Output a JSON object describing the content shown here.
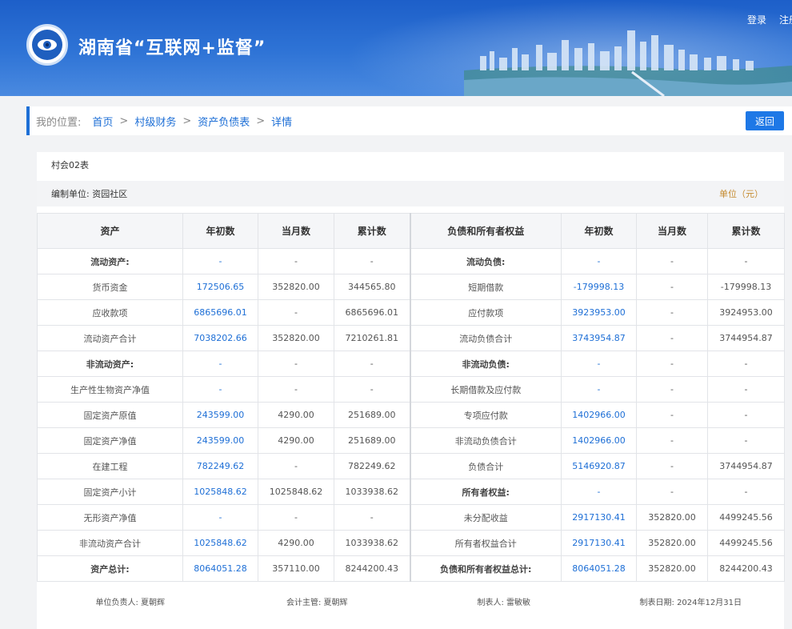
{
  "header": {
    "title": "湖南省“互联网+监督”",
    "login": "登录",
    "register": "注册"
  },
  "breadcrumb": {
    "label": "我的位置:",
    "items": [
      "首页",
      "村级财务",
      "资产负债表",
      "详情"
    ],
    "back": "返回"
  },
  "report": {
    "form_no": "村会02表",
    "org": "编制单位: 资园社区",
    "unit": "单位（元）",
    "columns": [
      "资产",
      "年初数",
      "当月数",
      "累计数",
      "负债和所有者权益",
      "年初数",
      "当月数",
      "累计数"
    ],
    "rows": [
      [
        {
          "t": "流动资产:",
          "b": true
        },
        {
          "t": "-",
          "c": "blue"
        },
        {
          "t": "-"
        },
        {
          "t": "-"
        },
        {
          "t": "流动负债:",
          "b": true
        },
        {
          "t": "-",
          "c": "blue"
        },
        {
          "t": "-"
        },
        {
          "t": "-"
        }
      ],
      [
        {
          "t": "货币资金"
        },
        {
          "t": "172506.65",
          "c": "blue"
        },
        {
          "t": "352820.00"
        },
        {
          "t": "344565.80"
        },
        {
          "t": "短期借款"
        },
        {
          "t": "-179998.13",
          "c": "blue"
        },
        {
          "t": "-"
        },
        {
          "t": "-179998.13"
        }
      ],
      [
        {
          "t": "应收款项"
        },
        {
          "t": "6865696.01",
          "c": "blue"
        },
        {
          "t": "-"
        },
        {
          "t": "6865696.01"
        },
        {
          "t": "应付款项"
        },
        {
          "t": "3923953.00",
          "c": "blue"
        },
        {
          "t": "-"
        },
        {
          "t": "3924953.00"
        }
      ],
      [
        {
          "t": "流动资产合计"
        },
        {
          "t": "7038202.66",
          "c": "blue"
        },
        {
          "t": "352820.00"
        },
        {
          "t": "7210261.81"
        },
        {
          "t": "流动负债合计"
        },
        {
          "t": "3743954.87",
          "c": "blue"
        },
        {
          "t": "-"
        },
        {
          "t": "3744954.87"
        }
      ],
      [
        {
          "t": "非流动资产:",
          "b": true
        },
        {
          "t": "-",
          "c": "blue"
        },
        {
          "t": "-"
        },
        {
          "t": "-"
        },
        {
          "t": "非流动负债:",
          "b": true
        },
        {
          "t": "-",
          "c": "blue"
        },
        {
          "t": "-"
        },
        {
          "t": "-"
        }
      ],
      [
        {
          "t": "生产性生物资产净值"
        },
        {
          "t": "-",
          "c": "blue"
        },
        {
          "t": "-"
        },
        {
          "t": "-"
        },
        {
          "t": "长期借款及应付款"
        },
        {
          "t": "-",
          "c": "blue"
        },
        {
          "t": "-"
        },
        {
          "t": "-"
        }
      ],
      [
        {
          "t": "固定资产原值"
        },
        {
          "t": "243599.00",
          "c": "blue"
        },
        {
          "t": "4290.00"
        },
        {
          "t": "251689.00"
        },
        {
          "t": "专项应付款"
        },
        {
          "t": "1402966.00",
          "c": "blue"
        },
        {
          "t": "-"
        },
        {
          "t": "-"
        }
      ],
      [
        {
          "t": "固定资产净值"
        },
        {
          "t": "243599.00",
          "c": "blue"
        },
        {
          "t": "4290.00"
        },
        {
          "t": "251689.00"
        },
        {
          "t": "非流动负债合计"
        },
        {
          "t": "1402966.00",
          "c": "blue"
        },
        {
          "t": "-"
        },
        {
          "t": "-"
        }
      ],
      [
        {
          "t": "在建工程"
        },
        {
          "t": "782249.62",
          "c": "blue"
        },
        {
          "t": "-"
        },
        {
          "t": "782249.62"
        },
        {
          "t": "负债合计"
        },
        {
          "t": "5146920.87",
          "c": "blue"
        },
        {
          "t": "-"
        },
        {
          "t": "3744954.87"
        }
      ],
      [
        {
          "t": "固定资产小计"
        },
        {
          "t": "1025848.62",
          "c": "blue"
        },
        {
          "t": "1025848.62"
        },
        {
          "t": "1033938.62"
        },
        {
          "t": "所有者权益:",
          "b": true
        },
        {
          "t": "-",
          "c": "blue"
        },
        {
          "t": "-"
        },
        {
          "t": "-"
        }
      ],
      [
        {
          "t": "无形资产净值"
        },
        {
          "t": "-",
          "c": "blue"
        },
        {
          "t": "-"
        },
        {
          "t": "-"
        },
        {
          "t": "未分配收益"
        },
        {
          "t": "2917130.41",
          "c": "blue"
        },
        {
          "t": "352820.00"
        },
        {
          "t": "4499245.56"
        }
      ],
      [
        {
          "t": "非流动资产合计"
        },
        {
          "t": "1025848.62",
          "c": "blue"
        },
        {
          "t": "4290.00"
        },
        {
          "t": "1033938.62"
        },
        {
          "t": "所有者权益合计"
        },
        {
          "t": "2917130.41",
          "c": "blue"
        },
        {
          "t": "352820.00"
        },
        {
          "t": "4499245.56"
        }
      ],
      [
        {
          "t": "资产总计:",
          "b": true
        },
        {
          "t": "8064051.28",
          "c": "blue"
        },
        {
          "t": "357110.00"
        },
        {
          "t": "8244200.43"
        },
        {
          "t": "负债和所有者权益总计:",
          "b": true
        },
        {
          "t": "8064051.28",
          "c": "blue"
        },
        {
          "t": "352820.00"
        },
        {
          "t": "8244200.43"
        }
      ]
    ],
    "footer": {
      "leader": "单位负责人: 夏朝辉",
      "accountant": "会计主管: 夏朝辉",
      "preparer": "制表人: 雷敏敏",
      "date": "制表日期: 2024年12月31日"
    }
  },
  "colors": {
    "accent": "#1e6fd6",
    "header": "#2f74d6",
    "unit_text": "#c58a2e"
  }
}
